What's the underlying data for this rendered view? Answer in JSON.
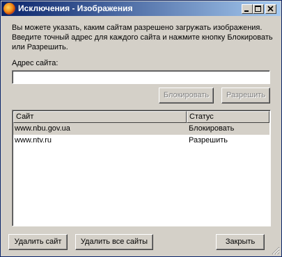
{
  "window": {
    "title": "Исключения - Изображения",
    "description": "Вы можете указать, каким сайтам разрешено загружать изображения. Введите точный адрес для каждого сайта и нажмите кнопку Блокировать или Разрешить."
  },
  "form": {
    "site_label": "Адрес сайта:",
    "site_value": "",
    "block_label": "Блокировать",
    "allow_label": "Разрешить"
  },
  "table": {
    "columns": [
      "Сайт",
      "Статус"
    ],
    "rows": [
      {
        "site": "www.nbu.gov.ua",
        "status": "Блокировать"
      },
      {
        "site": "www.ntv.ru",
        "status": "Разрешить"
      }
    ]
  },
  "footer": {
    "remove_site_label": "Удалить сайт",
    "remove_all_label": "Удалить все сайты",
    "close_label": "Закрыть"
  },
  "icons": {
    "app": "firefox-icon",
    "minimize": "minimize-icon",
    "maximize": "maximize-icon",
    "close": "close-icon"
  },
  "colors": {
    "titlebar_start": "#0a246a",
    "titlebar_end": "#a6caf0",
    "face": "#d4d0c8"
  }
}
